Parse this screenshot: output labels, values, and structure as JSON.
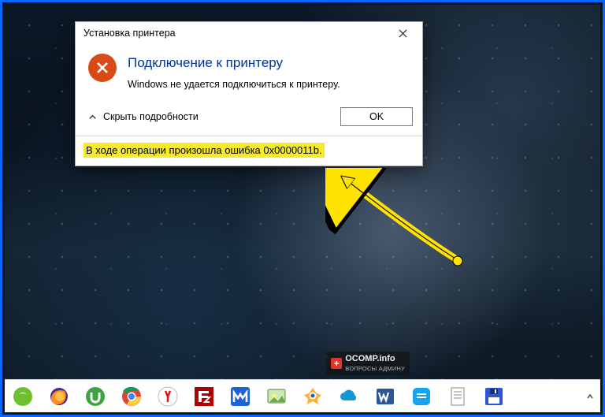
{
  "dialog": {
    "title": "Установка принтера",
    "heading": "Подключение к принтеру",
    "message": "Windows не удается подключиться к принтеру.",
    "toggle_details": "Скрыть подробности",
    "ok_label": "OK",
    "details_text": "В ходе операции произошла ошибка 0x0000011b."
  },
  "watermark": {
    "line1": "OCOMP.info",
    "line2": "ВОПРОСЫ АДМИНУ"
  },
  "taskbar": {
    "items": [
      {
        "name": "start-menu"
      },
      {
        "name": "firefox"
      },
      {
        "name": "utorrent"
      },
      {
        "name": "chrome"
      },
      {
        "name": "yandex-browser"
      },
      {
        "name": "filezilla"
      },
      {
        "name": "malwarebytes"
      },
      {
        "name": "paint-app"
      },
      {
        "name": "xnview"
      },
      {
        "name": "onedrive"
      },
      {
        "name": "word"
      },
      {
        "name": "messenger"
      },
      {
        "name": "notepad"
      },
      {
        "name": "save-disk"
      }
    ]
  }
}
